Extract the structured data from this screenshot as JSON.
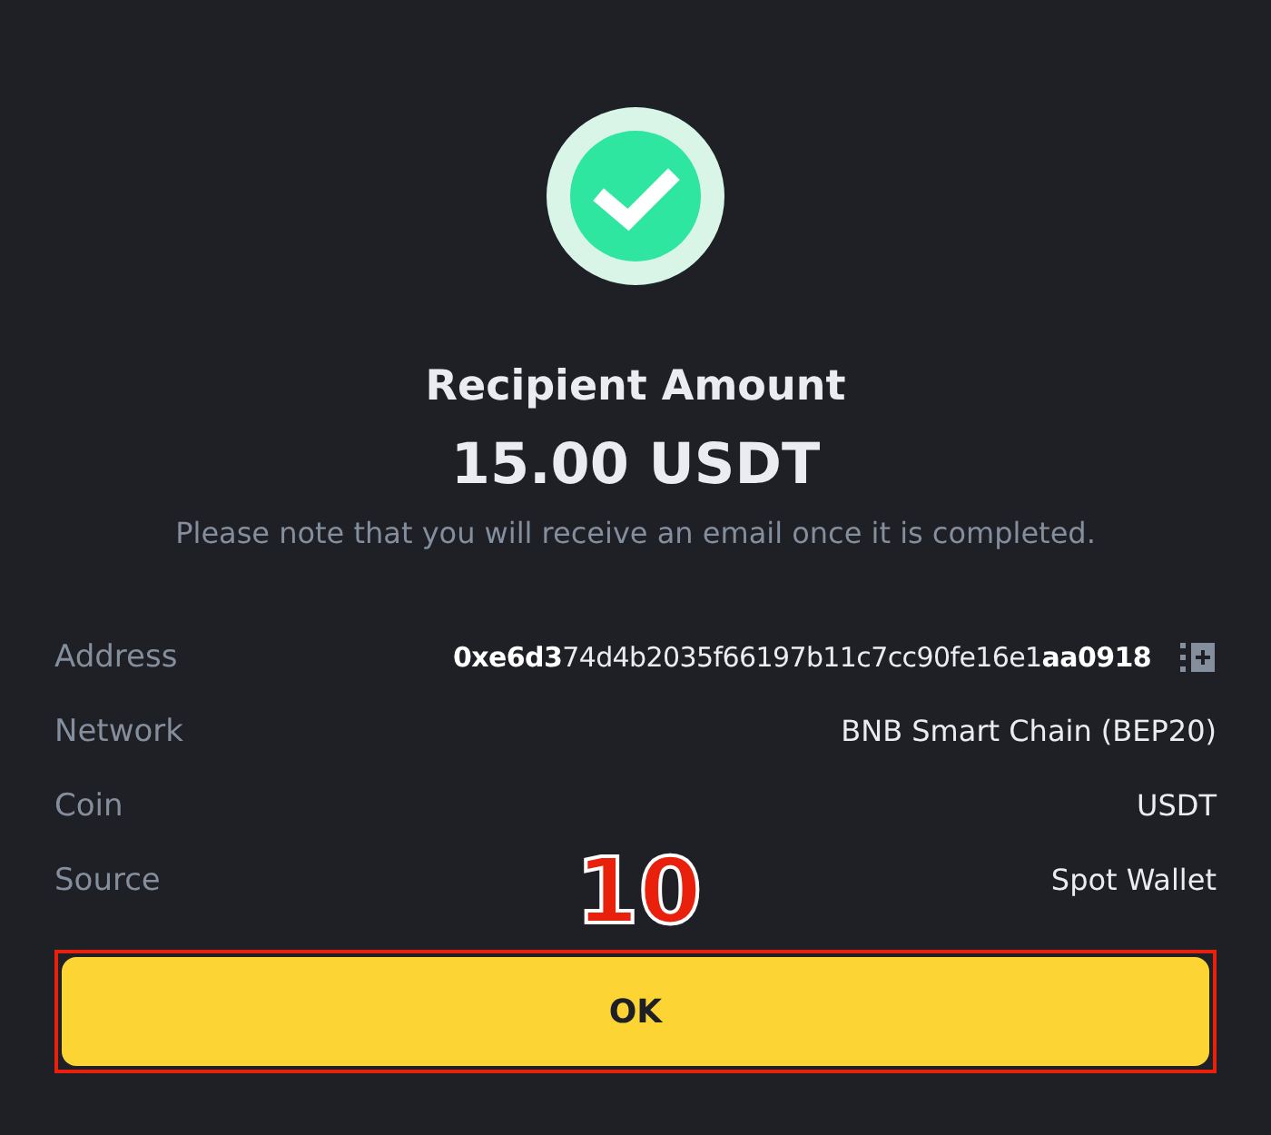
{
  "title": "Recipient Amount",
  "amount": "15.00 USDT",
  "note": "Please note that you will receive an email once it is completed.",
  "details": [
    {
      "label": "Address",
      "value": "**0xe6d3**74d4b2035f66197b11c7cc90fe16e1**aa0918**",
      "kind": "address"
    },
    {
      "label": "Network",
      "value": "BNB Smart Chain (BEP20)",
      "kind": "text"
    },
    {
      "label": "Coin",
      "value": "USDT",
      "kind": "text"
    },
    {
      "label": "Source",
      "value": "Spot Wallet",
      "kind": "text"
    }
  ],
  "step_marker": "10",
  "button": {
    "label": "OK",
    "highlighted": true
  }
}
